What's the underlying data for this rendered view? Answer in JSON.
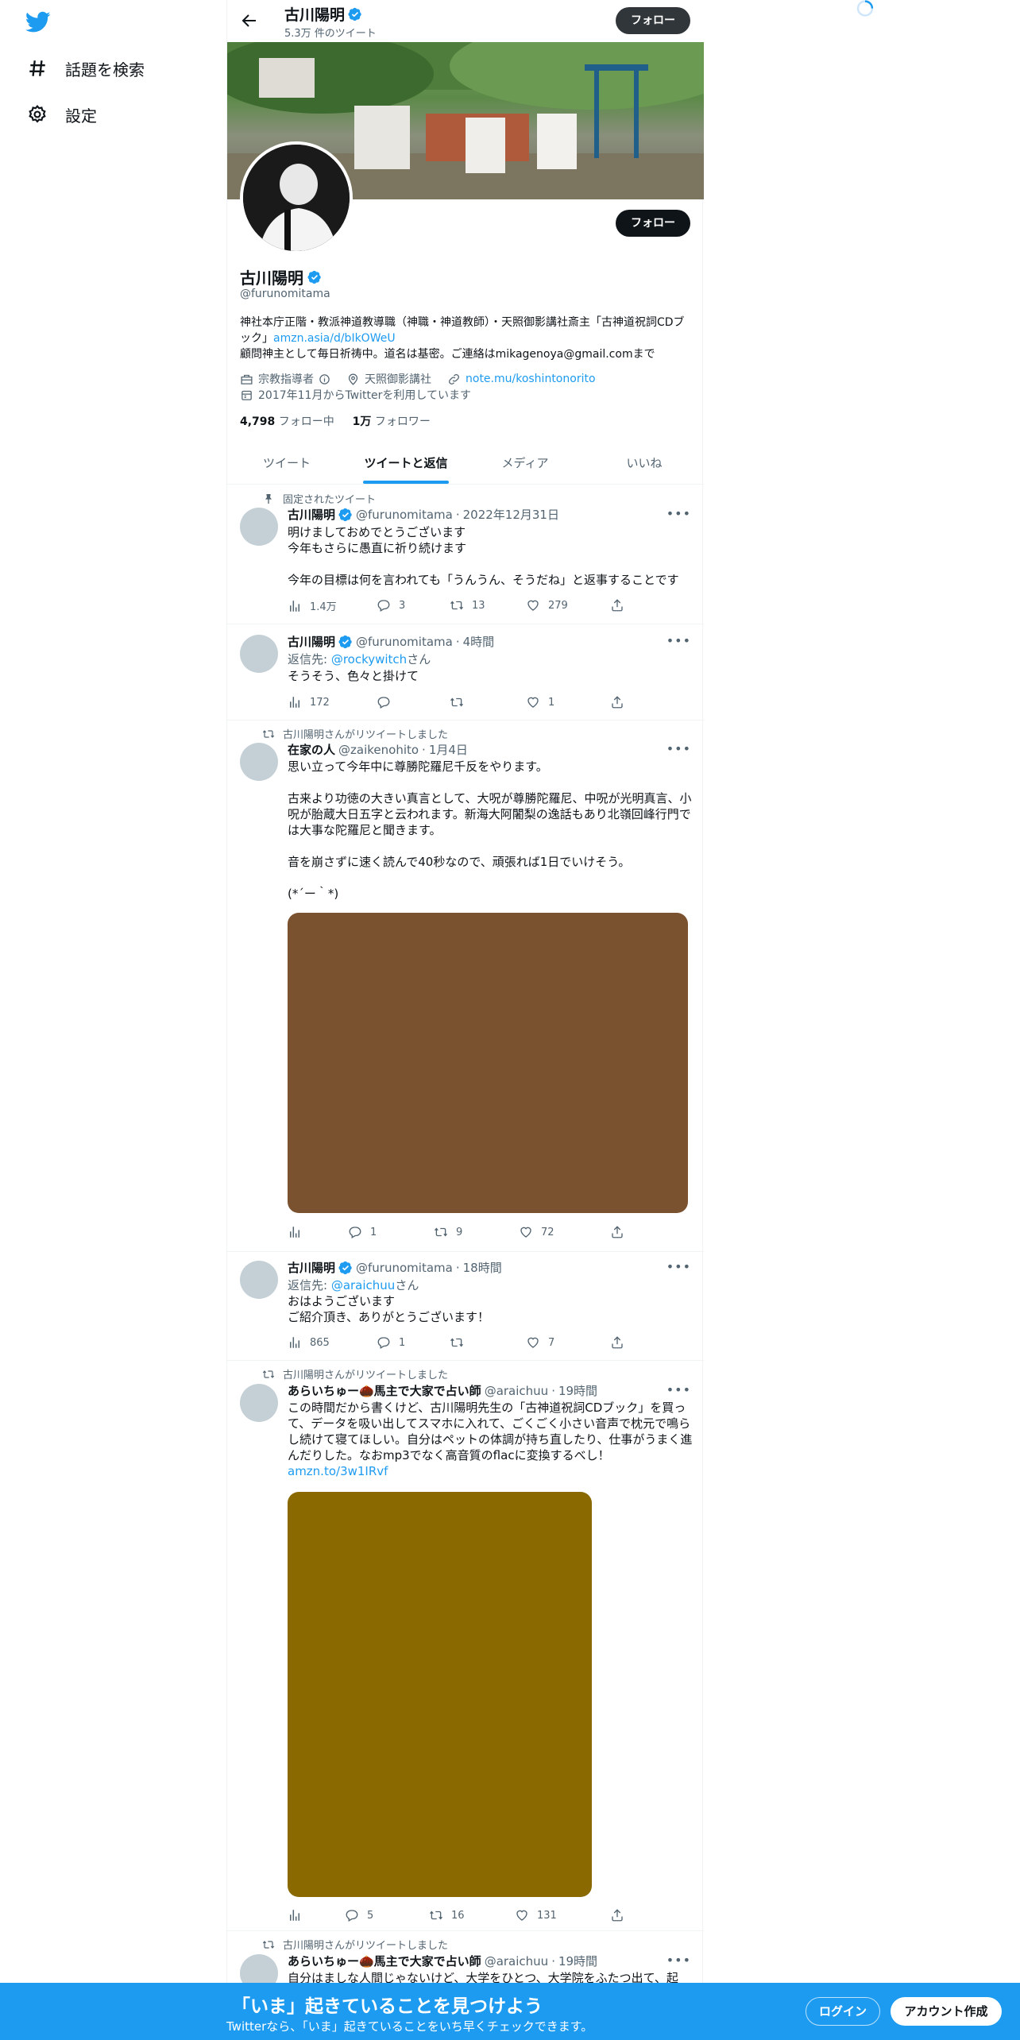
{
  "sidebar": {
    "items": [
      {
        "label": "話題を検索",
        "icon": "hashtag-icon"
      },
      {
        "label": "設定",
        "icon": "gear-icon"
      }
    ]
  },
  "header": {
    "name": "古川陽明",
    "tweet_count": "5.3万 件のツイート",
    "follow_label": "フォロー"
  },
  "profile": {
    "name": "古川陽明",
    "handle": "@furunomitama",
    "follow_label": "フォロー",
    "bio_line1": "神社本庁正階・教派神道教導職（神職・神道教師）・天照御影講社斎主「古神道祝詞CDブック」",
    "bio_link": "amzn.asia/d/bIkOWeU",
    "bio_line2": "顧問神主として毎日祈祷中。道名は基密。ご連絡はmikagenoya@gmail.comまで",
    "category": "宗教指導者",
    "location": "天照御影講社",
    "website": "note.mu/koshintonorito",
    "joined": "2017年11月からTwitterを利用しています",
    "following_count": "4,798",
    "following_label": "フォロー中",
    "followers_count": "1万",
    "followers_label": "フォロワー"
  },
  "tabs": [
    {
      "label": "ツイート",
      "active": false
    },
    {
      "label": "ツイートと返信",
      "active": true
    },
    {
      "label": "メディア",
      "active": false
    },
    {
      "label": "いいね",
      "active": false
    }
  ],
  "tweets": [
    {
      "social": "固定されたツイート",
      "name": "古川陽明",
      "handle": "@furunomitama",
      "time": "2022年12月31日",
      "text": "明けましておめでとうございます\n今年もさらに愚直に祈り続けます\n\n今年の目標は何を言われても「うんうん、そうだね」と返事することです",
      "views": "1.4万",
      "replies": "3",
      "retweets": "13",
      "likes": "279"
    },
    {
      "name": "古川陽明",
      "handle": "@furunomitama",
      "time": "4時間",
      "reply_prefix": "返信先: ",
      "reply_to": "@rockywitch",
      "reply_suffix": "さん",
      "text": "そうそう、色々と掛けて",
      "views": "172",
      "replies": "",
      "retweets": "",
      "likes": "1"
    },
    {
      "social": "古川陽明さんがリツイートしました",
      "name": "在家の人",
      "handle": "@zaikenohito",
      "time": "1月4日",
      "text": "思い立って今年中に尊勝陀羅尼千反をやります。\n\n古来より功徳の大きい真言として、大呪が尊勝陀羅尼、中呪が光明真言、小呪が胎蔵大日五字と云われます。新海大阿闍梨の逸話もあり北嶺回峰行門では大事な陀羅尼と聞きます。\n\n音を崩さずに速く読んで40秒なので、頑張れば1日でいけそう。\n\n(*´ー｀*)",
      "media_color": "#7a5230",
      "views": "",
      "replies": "1",
      "retweets": "9",
      "likes": "72"
    },
    {
      "name": "古川陽明",
      "handle": "@furunomitama",
      "time": "18時間",
      "reply_prefix": "返信先: ",
      "reply_to": "@araichuu",
      "reply_suffix": "さん",
      "text": "おはようございます\nご紹介頂き、ありがとうございます！",
      "views": "865",
      "replies": "1",
      "retweets": "",
      "likes": "7"
    },
    {
      "social": "古川陽明さんがリツイートしました",
      "name": "あらいちゅー🌰馬主で大家で占い師",
      "handle": "@araichuu",
      "time": "19時間",
      "text": "この時間だから書くけど、古川陽明先生の「古神道祝詞CDブック」を買って、データを吸い出してスマホに入れて、ごくごく小さい音声で枕元で鳴らし続けて寝てほしい。自分はペットの体調が持ち直したり、仕事がうまく進んだりした。なおmp3でなく高音質のflacに変換するべし！",
      "link": "amzn.to/3w1IRvf",
      "media_color": "#8a6a00",
      "views": "",
      "replies": "5",
      "retweets": "16",
      "likes": "131"
    },
    {
      "social": "古川陽明さんがリツイートしました",
      "name": "あらいちゅー🌰馬主で大家で占い師",
      "handle": "@araichuu",
      "time": "19時間",
      "text": "自分はましな人間じゃないけど、大学をひとつ、大学院をふたつ出て、起"
    }
  ],
  "bottom_bar": {
    "title": "「いま」起きていることを見つけよう",
    "subtitle": "Twitterなら、「いま」起きていることをいち早くチェックできます。",
    "login": "ログイン",
    "signup": "アカウント作成"
  },
  "colors": {
    "accent": "#1d9bf0",
    "text": "#0f1419",
    "muted": "#536471"
  }
}
